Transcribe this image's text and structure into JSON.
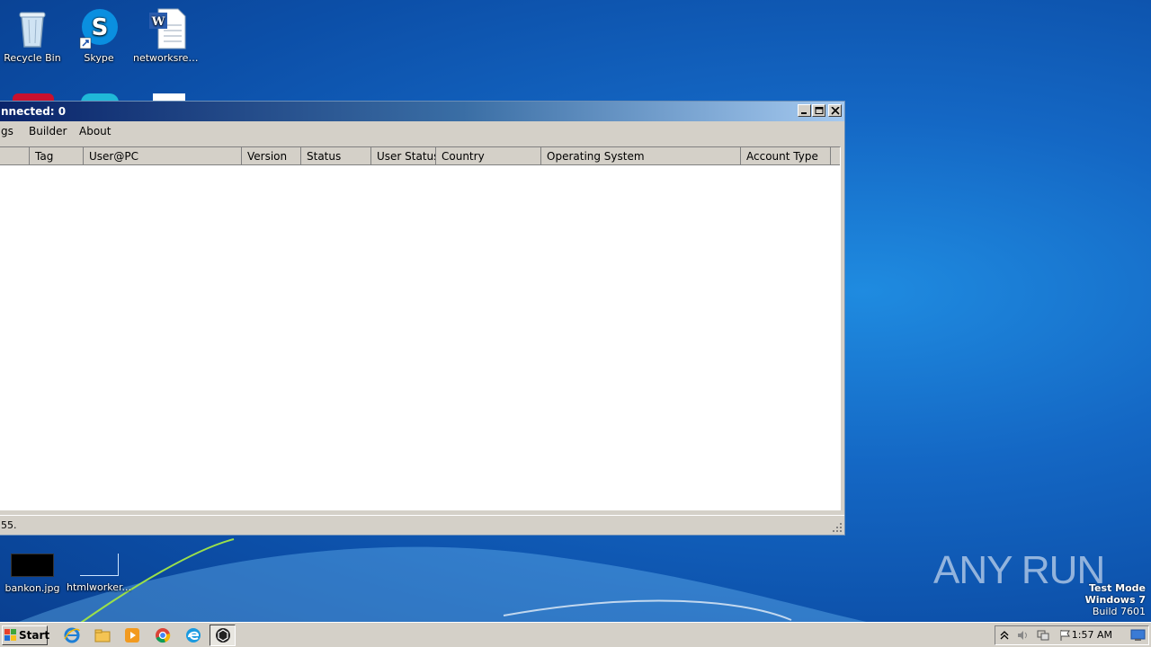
{
  "desktop": {
    "icons": [
      {
        "label": "Recycle Bin"
      },
      {
        "label": "Skype"
      },
      {
        "label": "networksres..."
      },
      {
        "label": "bankon.jpg"
      },
      {
        "label": "htmlworker..."
      }
    ]
  },
  "window": {
    "title": "nnected: 0",
    "menu": [
      "gs",
      "Builder",
      "About"
    ],
    "columns": [
      "Tag",
      "User@PC",
      "Version",
      "Status",
      "User Status",
      "Country",
      "Operating System",
      "Account Type"
    ],
    "status_text": "55."
  },
  "taskbar": {
    "start_label": "Start",
    "clock": "1:57 AM"
  },
  "watermark": {
    "line1": "Test Mode",
    "line2": "Windows 7",
    "line3": "Build 7601",
    "brand": "ANY RUN"
  }
}
